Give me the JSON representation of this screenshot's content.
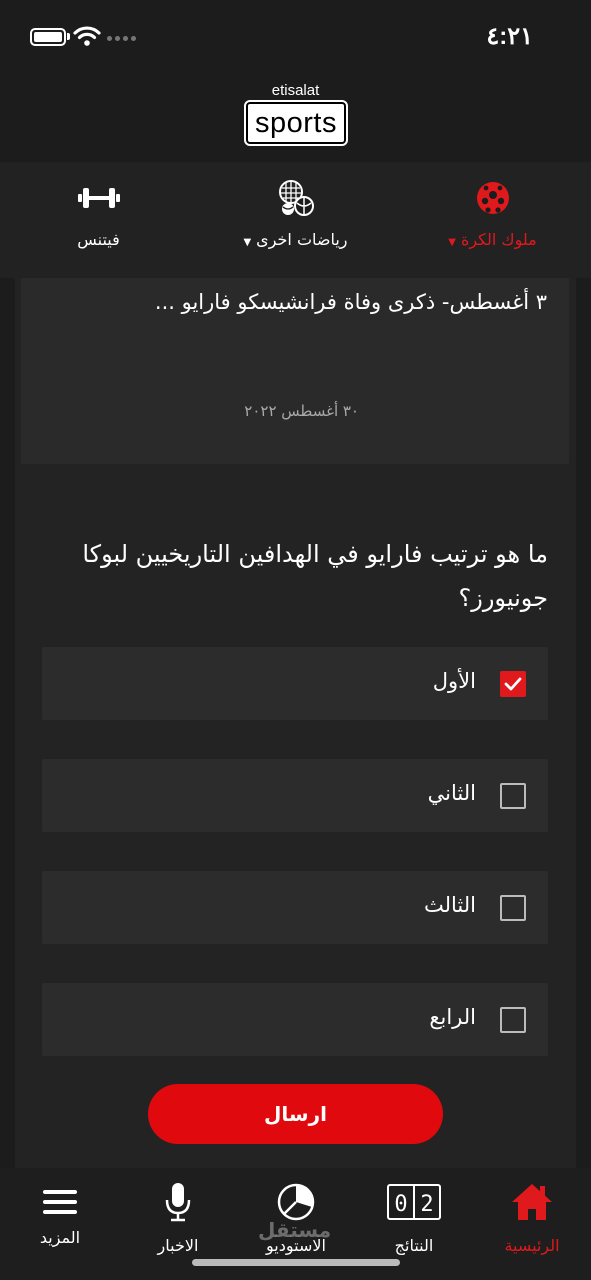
{
  "status_bar": {
    "time": "٤:٢١"
  },
  "brand": {
    "top_text": "etisalat",
    "logo_text": "sports"
  },
  "categories": [
    {
      "label": "ملوك الكرة",
      "icon": "soccer-ball-icon",
      "has_dropdown": true,
      "active": true
    },
    {
      "label": "رياضات اخرى",
      "icon": "sports-balls-icon",
      "has_dropdown": true,
      "active": false
    },
    {
      "label": "فيتنس",
      "icon": "dumbbell-icon",
      "has_dropdown": false,
      "active": false
    }
  ],
  "article": {
    "title": "٣ أغسطس- ذكرى وفاة فرانشيسكو فارايو ...",
    "date": "٣٠ أغسطس ٢٠٢٢"
  },
  "quiz": {
    "question": "ما هو ترتيب فارايو في الهدافين التاريخيين لبوكا جونيورز؟",
    "options": [
      {
        "label": "الأول",
        "checked": true
      },
      {
        "label": "الثاني",
        "checked": false
      },
      {
        "label": "الثالث",
        "checked": false
      },
      {
        "label": "الرابع",
        "checked": false
      }
    ],
    "submit_label": "ارسال"
  },
  "tabbar": {
    "items": [
      {
        "label": "الرئيسية",
        "icon": "home-icon",
        "active": true
      },
      {
        "label": "النتائج",
        "icon": "scoreboard-icon",
        "active": false
      },
      {
        "label": "الاستوديو",
        "icon": "studio-pie-icon",
        "active": false
      },
      {
        "label": "الاخبار",
        "icon": "microphone-icon",
        "active": false
      },
      {
        "label": "المزيد",
        "icon": "menu-icon",
        "active": false
      }
    ]
  },
  "watermark": "مستقل",
  "colors": {
    "accent": "#e0191d",
    "background": "#1c1c1c",
    "card": "#2c2c2c"
  }
}
